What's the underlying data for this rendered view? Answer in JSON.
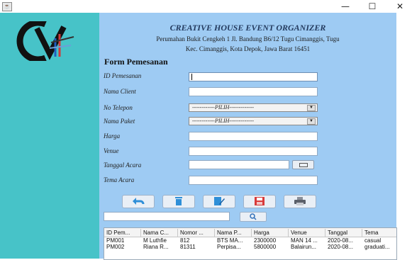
{
  "window": {
    "app_icon": "java-icon",
    "minimize": "—",
    "maximize": "☐",
    "close": "✕"
  },
  "header": {
    "title": "CREATIVE HOUSE EVENT ORGANIZER",
    "address_line1": "Perumahan Bukit Cengkeh 1 Jl. Bandung B6/12 Tugu Cimanggis, Tugu",
    "address_line2": "Kec. Cimanggis, Kota Depok, Jawa Barat 16451"
  },
  "form": {
    "title": "Form Pemesanan",
    "fields": [
      {
        "label": "ID Pemesanan",
        "value": ""
      },
      {
        "label": "Nama Client",
        "value": ""
      },
      {
        "label": "No Telepon",
        "value": "------------PILIH-------------"
      },
      {
        "label": "Nama Paket",
        "value": "------------PILIH-------------"
      },
      {
        "label": "Harga",
        "value": ""
      },
      {
        "label": "Venue",
        "value": ""
      },
      {
        "label": "Tanggal Acara",
        "value": ""
      },
      {
        "label": "Tema Acara",
        "value": ""
      }
    ]
  },
  "actions": {
    "buttons": [
      {
        "name": "undo-icon",
        "color": "#2f8fd8"
      },
      {
        "name": "trash-icon",
        "color": "#2f8fd8"
      },
      {
        "name": "edit-icon",
        "color": "#2f8fd8"
      },
      {
        "name": "save-icon",
        "color": "#d83a3a"
      },
      {
        "name": "print-icon",
        "color": "#6b6f78"
      }
    ]
  },
  "search": {
    "value": "",
    "icon": "search-icon"
  },
  "table": {
    "columns": [
      "ID Pem...",
      "Nama C...",
      "Nomor ...",
      "Nama P...",
      "Harga",
      "Venue",
      "Tanggal",
      "Tema"
    ],
    "rows": [
      [
        "PM001",
        "M Luthfie",
        "812",
        "BTS MA...",
        "2300000",
        "MAN 14 ...",
        "2020-08...",
        "casual"
      ],
      [
        "PM002",
        "Riana R...",
        "81311",
        "Perpisa...",
        "5800000",
        "Balairun...",
        "2020-08...",
        "graduati..."
      ]
    ]
  }
}
